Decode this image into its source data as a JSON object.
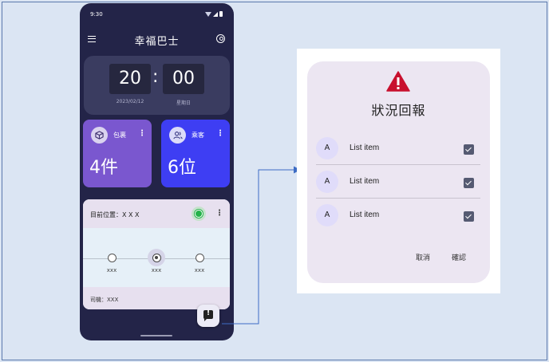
{
  "status_bar": {
    "time": "9:30"
  },
  "app_bar": {
    "title": "幸福巴士"
  },
  "clock": {
    "hour": "20",
    "separator": ":",
    "minute": "00",
    "date": "2023/02/12",
    "weekday": "星期日"
  },
  "stats": {
    "package": {
      "label": "包裹",
      "value": "4件",
      "icon": "package-icon"
    },
    "passenger": {
      "label": "乘客",
      "value": "6位",
      "icon": "people-icon"
    }
  },
  "location": {
    "title": "目前位置：X X X",
    "stops": [
      {
        "label": "xxx"
      },
      {
        "label": "xxx"
      },
      {
        "label": "xxx"
      }
    ],
    "current_stop_index": 1,
    "driver": "司機：XXX"
  },
  "dialog": {
    "title": "狀況回報",
    "items": [
      {
        "avatar": "A",
        "label": "List item",
        "checked": true
      },
      {
        "avatar": "A",
        "label": "List item",
        "checked": true
      },
      {
        "avatar": "A",
        "label": "List item",
        "checked": true
      }
    ],
    "cancel_label": "取消",
    "confirm_label": "確認"
  },
  "colors": {
    "phone_background": "#232448",
    "package_card": "#7a57cf",
    "passenger_card": "#3e3ef3",
    "warning_red": "#c8102e",
    "status_green": "#25b24a",
    "connector_blue": "#3d6cc4",
    "dialog_surface": "#ece6f2"
  }
}
